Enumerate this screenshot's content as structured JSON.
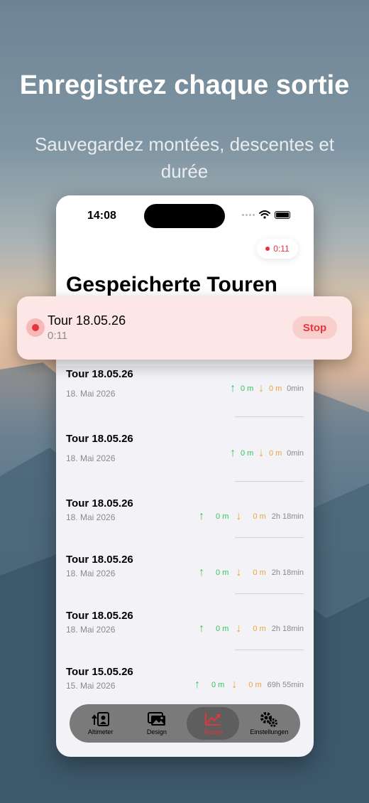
{
  "hero": {
    "title": "Enregistrez chaque sortie",
    "subtitle": "Sauvegardez montées, descentes et durée"
  },
  "status_bar": {
    "time": "14:08"
  },
  "recording_pill": {
    "time": "0:11"
  },
  "page": {
    "title": "Gespeicherte Touren"
  },
  "active_tour": {
    "title": "Tour 18.05.26",
    "elapsed": "0:11",
    "stop_label": "Stop"
  },
  "tours": [
    {
      "title": "Tour 18.05.26",
      "date": "18. Mai 2026",
      "ascent": "0 m",
      "descent": "0 m",
      "duration": "0min"
    },
    {
      "title": "Tour 18.05.26",
      "date": "18. Mai 2026",
      "ascent": "0 m",
      "descent": "0 m",
      "duration": "0min"
    },
    {
      "title": "Tour 18.05.26",
      "date": "18. Mai 2026",
      "ascent": "0 m",
      "descent": "0 m",
      "duration": "2h 18min"
    },
    {
      "title": "Tour 18.05.26",
      "date": "18. Mai 2026",
      "ascent": "0 m",
      "descent": "0 m",
      "duration": "2h 18min"
    },
    {
      "title": "Tour 18.05.26",
      "date": "18. Mai 2026",
      "ascent": "0 m",
      "descent": "0 m",
      "duration": "2h 18min"
    },
    {
      "title": "Tour 15.05.26",
      "date": "15. Mai 2026",
      "ascent": "0 m",
      "descent": "0 m",
      "duration": "69h 55min"
    }
  ],
  "tabbar": {
    "tabs": [
      {
        "label": "Altimeter",
        "icon": "altimeter-icon"
      },
      {
        "label": "Design",
        "icon": "photos-icon"
      },
      {
        "label": "Touren",
        "icon": "chart-line-icon",
        "active": true
      },
      {
        "label": "Einstellungen",
        "icon": "gears-icon"
      }
    ]
  },
  "colors": {
    "accent_red": "#e5343d",
    "ascent_green": "#34c759",
    "descent_orange": "#f0a33a"
  }
}
